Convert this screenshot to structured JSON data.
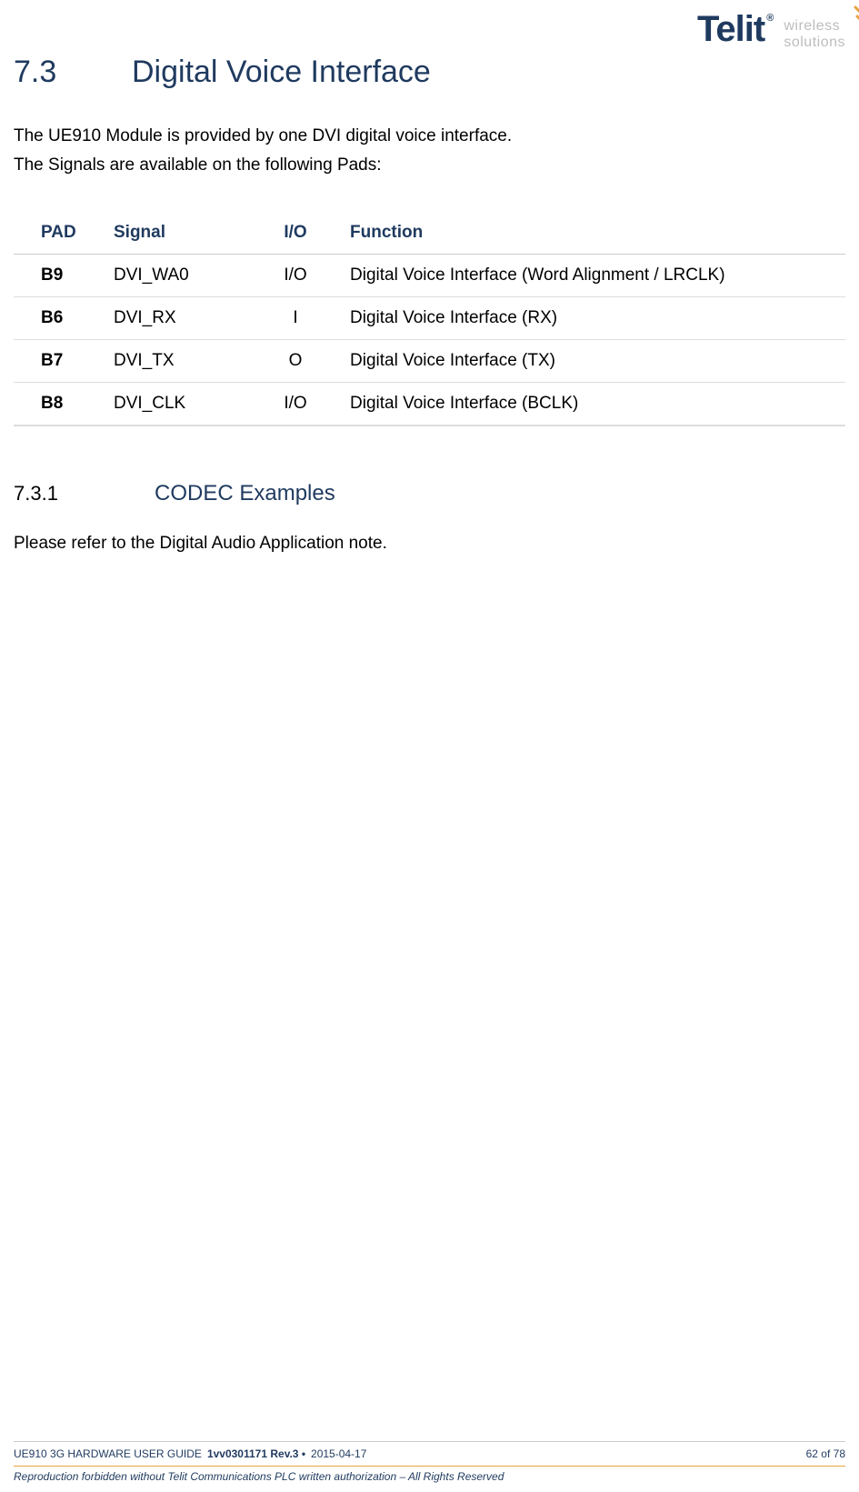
{
  "logo": {
    "brand": "Telit",
    "reg": "®",
    "tagline1": "wireless",
    "tagline2": "solutions"
  },
  "section": {
    "num": "7.3",
    "title": "Digital Voice Interface",
    "p1": "The UE910 Module is provided by one DVI digital voice interface.",
    "p2": "The Signals are available on the following Pads:"
  },
  "table": {
    "headers": {
      "pad": "PAD",
      "signal": "Signal",
      "io": "I/O",
      "function": "Function"
    },
    "rows": [
      {
        "pad": "B9",
        "signal": "DVI_WA0",
        "io": "I/O",
        "function": "Digital Voice Interface (Word Alignment / LRCLK)"
      },
      {
        "pad": "B6",
        "signal": "DVI_RX",
        "io": "I",
        "function": "Digital Voice Interface (RX)"
      },
      {
        "pad": "B7",
        "signal": "DVI_TX",
        "io": "O",
        "function": "Digital Voice Interface (TX)"
      },
      {
        "pad": "B8",
        "signal": "DVI_CLK",
        "io": "I/O",
        "function": "Digital Voice Interface (BCLK)"
      }
    ]
  },
  "subsection": {
    "num": "7.3.1",
    "title": "CODEC Examples",
    "p1": "Please refer to the Digital Audio Application note."
  },
  "footer": {
    "doc_title": "UE910 3G HARDWARE USER GUIDE",
    "doc_rev": "1vv0301171 Rev.3 •",
    "doc_date": "2015-04-17",
    "page": "62 of 78",
    "copy": "Reproduction forbidden without Telit Communications PLC written authorization – All Rights Reserved"
  }
}
